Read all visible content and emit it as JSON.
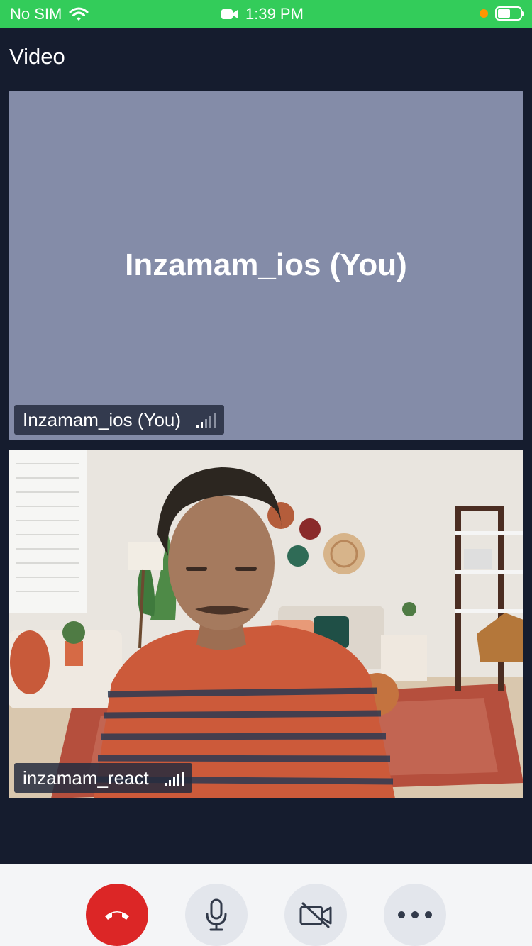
{
  "status_bar": {
    "carrier": "No SIM",
    "time": "1:39 PM",
    "battery_level": 0.55
  },
  "page": {
    "title": "Video"
  },
  "tiles": {
    "self": {
      "display_name": "Inzamam_ios (You)",
      "label": "Inzamam_ios (You)",
      "background_color": "#848ca8",
      "signal_bars": 2
    },
    "remote": {
      "label": "inzamam_react",
      "signal_bars": 5
    }
  },
  "controls": {
    "end_call": {
      "icon": "phone-hangup-icon",
      "color": "#dc2626"
    },
    "mic": {
      "icon": "microphone-icon"
    },
    "camera": {
      "icon": "video-off-icon"
    },
    "more": {
      "icon": "more-icon"
    }
  },
  "colors": {
    "status_bar": "#33cc5a",
    "background": "#151c2e",
    "control_bar": "#f4f5f7"
  }
}
